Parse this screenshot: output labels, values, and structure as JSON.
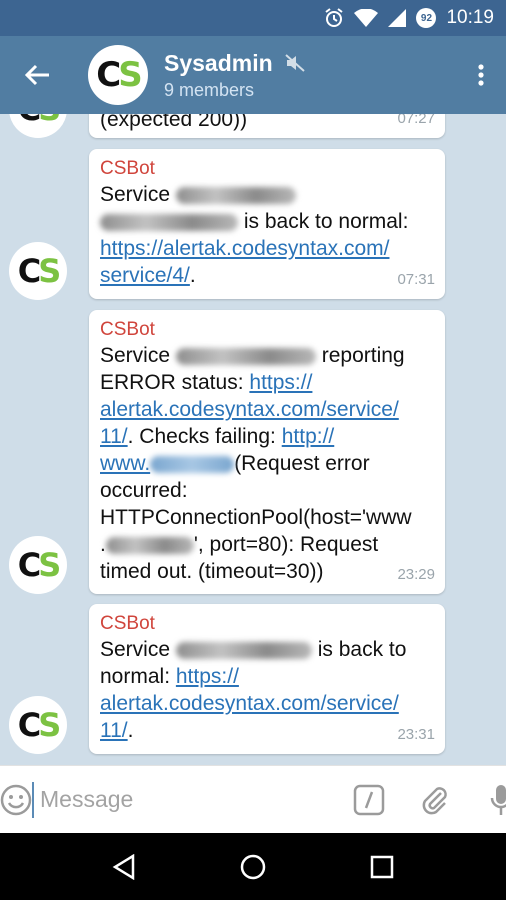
{
  "status_bar": {
    "time": "10:19",
    "battery_level": "92"
  },
  "header": {
    "title": "Sysadmin",
    "subtitle": "9 members",
    "avatar_left": "C",
    "avatar_right": "S"
  },
  "messages": [
    {
      "text": "(expected 200))",
      "time": "07:27"
    },
    {
      "sender": "CSBot",
      "time": "07:31",
      "l1": "Service",
      "l2": "is back to normal:",
      "l3": "https://alertak.codesyntax.com/",
      "l4": "service/4/",
      "l4_end": "."
    },
    {
      "sender": "CSBot",
      "time": "23:29",
      "l1a": "Service",
      "l1b": "reporting",
      "l2a": "ERROR status:",
      "l2b": "https://",
      "l3": "alertak.codesyntax.com/service/",
      "l4a": "11/",
      "l4b": ". Checks failing:",
      "l4c": "http://",
      "l5a": "www.",
      "l5b": "(Request error",
      "l6": "occurred:",
      "l7": "HTTPConnectionPool(host='www",
      "l8a": ".",
      "l8b": "', port=80): Request",
      "l9": "timed out. (timeout=30))"
    },
    {
      "sender": "CSBot",
      "time": "23:31",
      "l1a": "Service",
      "l1b": "is back to",
      "l2a": "normal:",
      "l2b": "https://",
      "l3": "alertak.codesyntax.com/service/",
      "l4a": "11/",
      "l4b": "."
    }
  ],
  "input": {
    "placeholder": "Message"
  },
  "colors": {
    "header": "#517da2",
    "status_bar": "#3d6591",
    "chat_bg": "#cfdde8",
    "sender": "#d0453c",
    "link": "#2a73b8",
    "avatar_s": "#7cc242"
  }
}
